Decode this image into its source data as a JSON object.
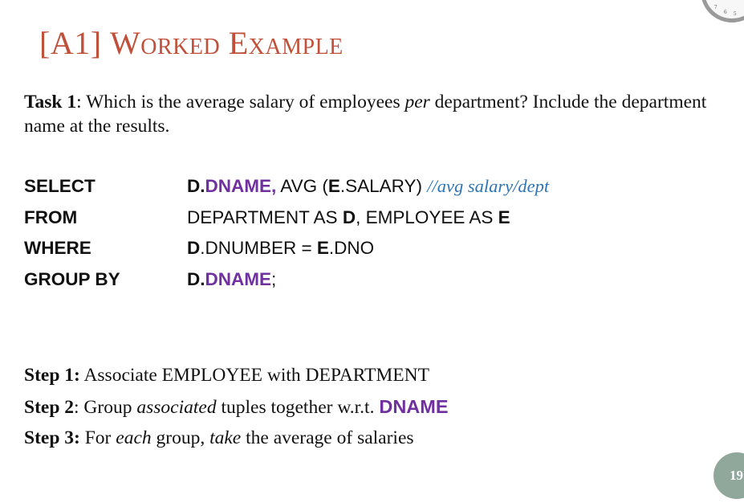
{
  "title": {
    "bracket": "[A1] ",
    "word1": "Worked",
    "word2": "Example"
  },
  "task": {
    "label": "Task 1",
    "part1": ": Which is the average salary of employees ",
    "emph": "per",
    "part2": " department? Include the department name at the results."
  },
  "query": {
    "select": {
      "keyword": "SELECT",
      "alias1": "D.",
      "col1": "DNAME,",
      "func": " AVG (",
      "alias2": "E",
      "col2": ".SALARY) ",
      "comment": "//avg salary/dept"
    },
    "from": {
      "keyword": "FROM",
      "t1": "DEPARTMENT AS ",
      "a1": "D",
      "t2": ", EMPLOYEE AS ",
      "a2": "E"
    },
    "where": {
      "keyword": "WHERE",
      "a1": "D",
      "c1": ".DNUMBER = ",
      "a2": "E",
      "c2": ".DNO"
    },
    "group_by": {
      "keyword": "GROUP BY",
      "alias": "D.",
      "col": "DNAME",
      "end": ";"
    }
  },
  "steps": [
    {
      "label": "Step 1:",
      "t1": " Associate EMPLOYEE with DEPARTMENT"
    },
    {
      "label": "Step 2",
      "t1": ": Group ",
      "em1": "associated",
      "t2": " tuples together w.r.t. ",
      "hl": "DNAME"
    },
    {
      "label": "Step 3:",
      "t1": " For ",
      "em1": "each",
      "t2": " group, ",
      "em2": "take",
      "t3": " the average of salaries"
    }
  ],
  "page_number": "19",
  "clock_digits": [
    "7",
    "6",
    "5"
  ],
  "colors": {
    "title": "#c0503a",
    "highlight": "#7030a0",
    "comment": "#2e75b6",
    "page_badge": "#8fa89b"
  },
  "icons": [
    "clock-icon"
  ]
}
